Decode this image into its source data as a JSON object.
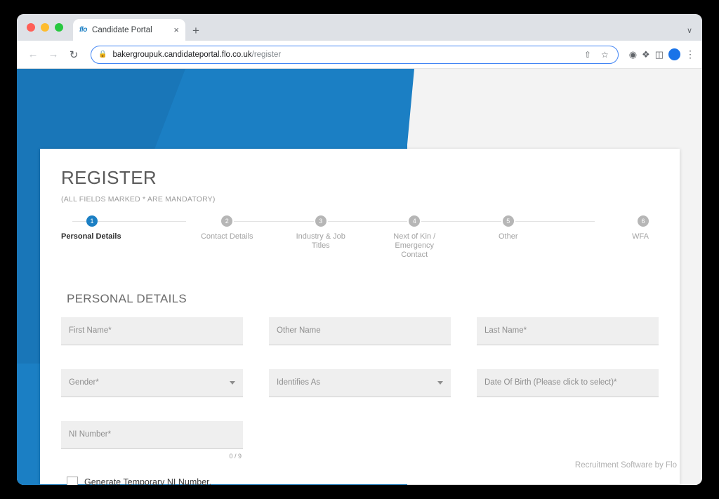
{
  "browser": {
    "traffic_lights": [
      "close",
      "minimize",
      "zoom"
    ],
    "tab": {
      "favicon_text": "flo",
      "title": "Candidate Portal",
      "close_label": "×"
    },
    "new_tab_label": "+",
    "tabstrip_chevron": "∨",
    "toolbar": {
      "back_label": "←",
      "forward_label": "→",
      "reload_label": "↻",
      "lock_icon": "🔒",
      "url_domain": "bakergroupuk.candidateportal.flo.co.uk",
      "url_path": "/register",
      "share_label": "⇧",
      "bookmark_label": "☆",
      "extension_icons": [
        "shield-icon",
        "puzzle-icon",
        "sidepanel-icon"
      ],
      "avatar_initial": "",
      "menu_label": "⋮"
    }
  },
  "page": {
    "title": "REGISTER",
    "subtitle": "(ALL FIELDS MARKED * ARE MANDATORY)",
    "section_title": "PERSONAL DETAILS",
    "footer": "Recruitment Software by Flo",
    "accent_color": "#1b7fc4",
    "step_inactive_color": "#b6b6b6"
  },
  "stepper": {
    "steps": [
      {
        "number": "1",
        "label": "Personal Details",
        "active": true
      },
      {
        "number": "2",
        "label": "Contact Details",
        "active": false
      },
      {
        "number": "3",
        "label": "Industry & Job Titles",
        "active": false
      },
      {
        "number": "4",
        "label": "Next of Kin / Emergency Contact",
        "active": false
      },
      {
        "number": "5",
        "label": "Other",
        "active": false
      },
      {
        "number": "6",
        "label": "WFA",
        "active": false
      }
    ]
  },
  "form": {
    "first_name": {
      "label": "First Name*",
      "value": ""
    },
    "other_name": {
      "label": "Other Name",
      "value": ""
    },
    "last_name": {
      "label": "Last Name*",
      "value": ""
    },
    "gender": {
      "label": "Gender*",
      "value": ""
    },
    "identifies_as": {
      "label": "Identifies As",
      "value": ""
    },
    "date_of_birth": {
      "label": "Date Of Birth (Please click to select)*",
      "value": ""
    },
    "ni_number": {
      "label": "NI Number*",
      "value": "",
      "counter": "0 / 9"
    },
    "generate_temp_ni": {
      "label": "Generate Temporary NI Number.",
      "checked": false
    }
  }
}
